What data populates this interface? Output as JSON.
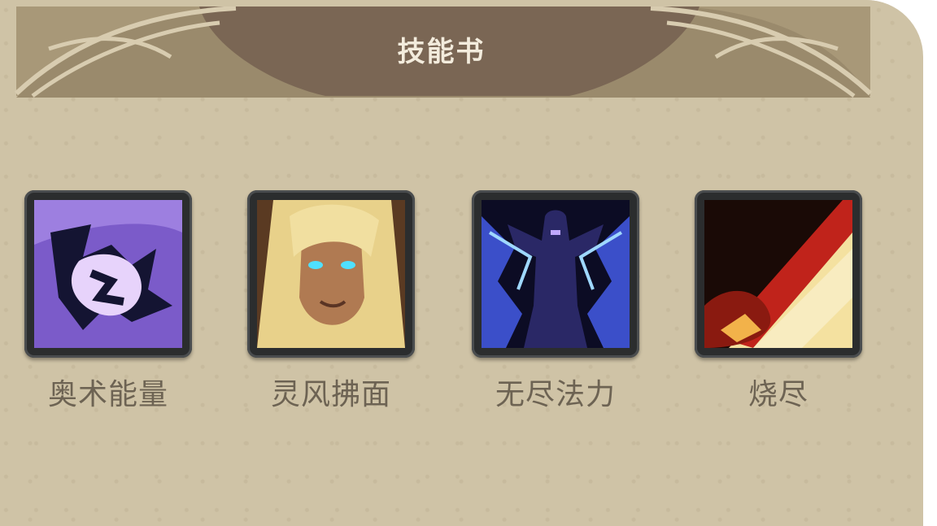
{
  "panel": {
    "title": "技能书"
  },
  "skills": [
    {
      "name": "奥术能量",
      "icon": "arcane-energy-icon"
    },
    {
      "name": "灵风拂面",
      "icon": "elf-face-icon"
    },
    {
      "name": "无尽法力",
      "icon": "endless-mana-icon"
    },
    {
      "name": "烧尽",
      "icon": "burnout-icon"
    }
  ],
  "colors": {
    "panel_bg": "#cfc3a6",
    "banner": "#7a6654",
    "label": "#6d6353",
    "frame": "#2b2d2e"
  }
}
